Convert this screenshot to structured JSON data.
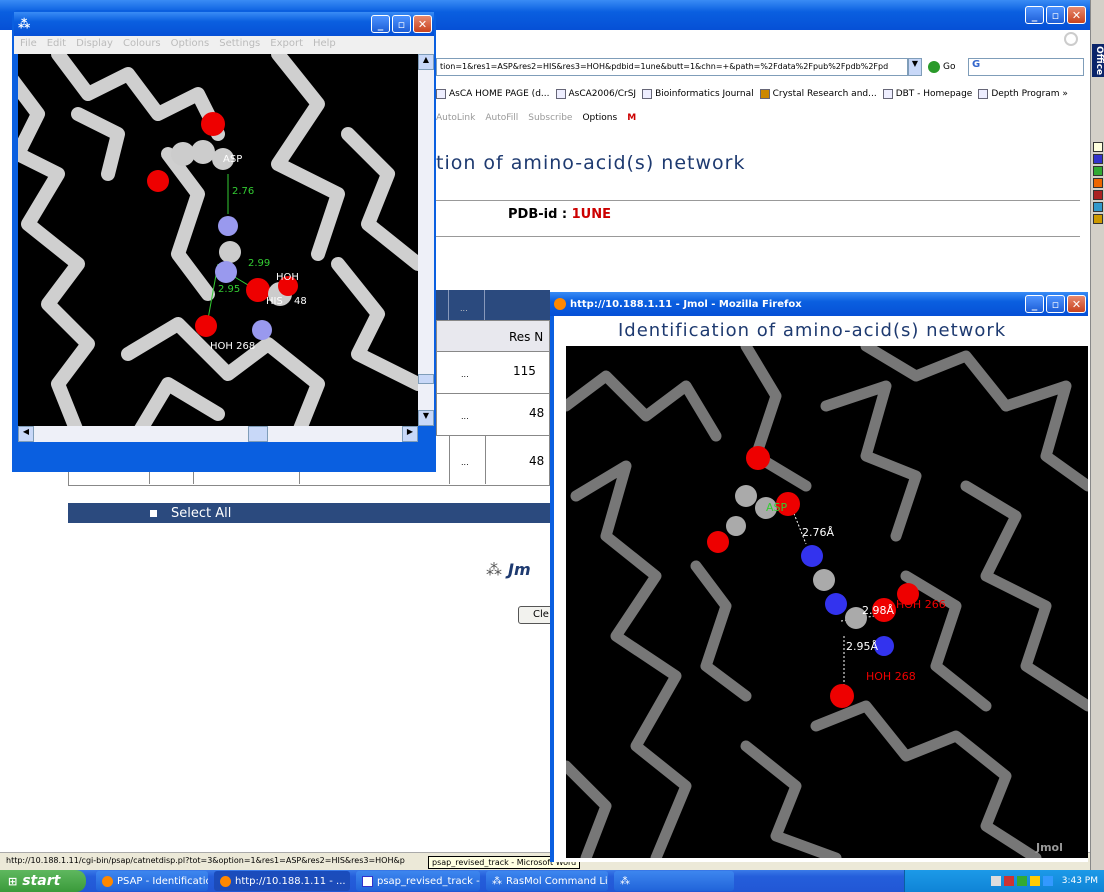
{
  "browser_main": {
    "address": "tion=1&res1=ASP&res2=HIS&res3=HOH&pdbid=1une&butt=1&chn=+&path=%2Fdata%2Fpub%2Fpdb%2Fpd",
    "go_label": "Go",
    "bookmarks": [
      "AsCA HOME PAGE (d...",
      "AsCA2006/CrSJ",
      "Bioinformatics Journal",
      "Crystal Research and...",
      "DBT - Homepage",
      "Depth Program »"
    ],
    "toolbar_items": [
      "AutoLink",
      "AutoFill",
      "Subscribe",
      "Options"
    ],
    "page_heading": "tion of amino-acid(s) network",
    "pdb_label": "PDB-id : ",
    "pdb_value": "1UNE",
    "table_header_dots": "...",
    "table_header_res": "Res N",
    "rows": [
      {
        "dots": "...",
        "value": "115"
      },
      {
        "dots": "...",
        "value": "48"
      },
      {
        "dots": "...",
        "value": "48"
      }
    ],
    "select_all": "Select All",
    "jmol_logo_text": "Jm",
    "clear_button": "Cle",
    "status_url": "http://10.188.1.11/cgi-bin/psap/catnetdisp.pl?tot=3&option=1&res1=ASP&res2=HIS&res3=HOH&p",
    "tooltip": "psap_revised_track - Microsoft Word"
  },
  "rasmol": {
    "title_icon": "rasmol-icon",
    "menu": [
      "File",
      "Edit",
      "Display",
      "Colours",
      "Options",
      "Settings",
      "Export",
      "Help"
    ],
    "labels": [
      "ASP",
      "2.76",
      "2.99",
      "HOH",
      "HIS",
      "48",
      "2.95",
      "HOH 268"
    ]
  },
  "jmol_window": {
    "title": "http://10.188.1.11 - Jmol - Mozilla Firefox",
    "heading": "Identification of amino-acid(s) network",
    "labels": [
      "ASP",
      "2.76Å",
      "2.98Å",
      "HOH 266",
      "2.95Å",
      "HOH 268"
    ],
    "watermark": "Jmol"
  },
  "taskbar": {
    "start": "start",
    "items": [
      "PSAP - Identification ...",
      "http://10.188.1.11 - ...",
      "psap_revised_track - ...",
      "RasMol Command Line"
    ],
    "clock": "3:43 PM"
  },
  "right_toolbar": {
    "office_label": "Office"
  },
  "colors": {
    "xp_blue": "#0a5fe0",
    "select_bar": "#2b4a7e",
    "pdb_red": "#cc0000",
    "atom_red": "#e00000",
    "atom_blue": "#3a3aee"
  }
}
